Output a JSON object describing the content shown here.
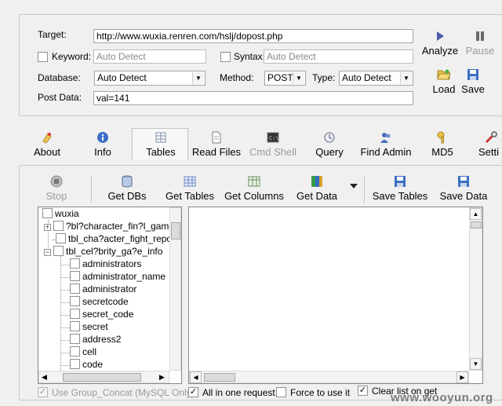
{
  "form": {
    "target_label": "Target:",
    "target_value": "http://www.wuxia.renren.com/hslj/dopost.php",
    "keyword_label": "Keyword:",
    "keyword_placeholder": "Auto Detect",
    "syntax_label": "Syntax:",
    "syntax_placeholder": "Auto Detect",
    "database_label": "Database:",
    "database_value": "Auto Detect",
    "method_label": "Method:",
    "method_value": "POST",
    "type_label": "Type:",
    "type_value": "Auto Detect",
    "postdata_label": "Post Data:",
    "postdata_value": "val=141"
  },
  "side_buttons": {
    "analyze": "Analyze",
    "pause": "Pause",
    "load": "Load",
    "save": "Save"
  },
  "tabs": [
    {
      "label": "About",
      "icon": "about-icon"
    },
    {
      "label": "Info",
      "icon": "info-icon"
    },
    {
      "label": "Tables",
      "icon": "tables-icon",
      "selected": true
    },
    {
      "label": "Read Files",
      "icon": "file-icon"
    },
    {
      "label": "Cmd Shell",
      "icon": "terminal-icon",
      "disabled": true
    },
    {
      "label": "Query",
      "icon": "query-icon"
    },
    {
      "label": "Find Admin",
      "icon": "admin-icon"
    },
    {
      "label": "MD5",
      "icon": "key-icon"
    },
    {
      "label": "Setti",
      "icon": "settings-icon"
    }
  ],
  "toolbar": {
    "stop": "Stop",
    "get_dbs": "Get DBs",
    "get_tables": "Get Tables",
    "get_columns": "Get Columns",
    "get_data": "Get Data",
    "save_tables": "Save Tables",
    "save_data": "Save Data"
  },
  "tree": {
    "root": "wuxia",
    "tables": [
      "?bl?character_fin?l_game?",
      "tbl_cha?acter_fight_repo?l",
      "tbl_cel?brity_ga?e_info"
    ],
    "columns": [
      "administrators",
      "administrator_name",
      "administrator",
      "secretcode",
      "secret_code",
      "secret",
      "address2",
      "cell",
      "code"
    ]
  },
  "footer": {
    "group_concat": "Use Group_Concat (MySQL Only)",
    "all_in_one": "All in one request.",
    "force": "Force to use it",
    "clear_list": "Clear list on get",
    "watermark": "www.wooyun.org"
  }
}
